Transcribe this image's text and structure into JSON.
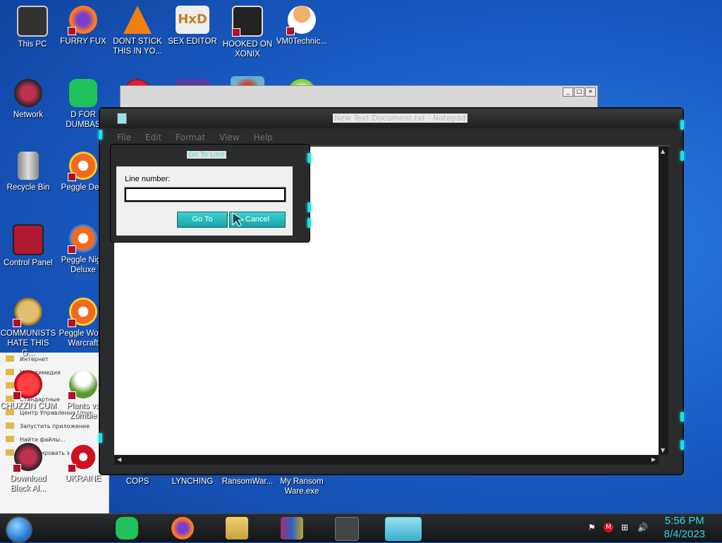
{
  "desktop": {
    "icons": [
      {
        "label": "This PC"
      },
      {
        "label": "FURRY FUX"
      },
      {
        "label": "DONT STICK THIS IN YO..."
      },
      {
        "label": "SEX EDITOR"
      },
      {
        "label": "HOOKED ON XONIX"
      },
      {
        "label": "VM0Technic..."
      },
      {
        "label": "Network"
      },
      {
        "label": "D FOR DUMBAS"
      },
      {
        "label": "Recycle Bin"
      },
      {
        "label": "Peggle Delu"
      },
      {
        "label": "Control Panel"
      },
      {
        "label": "Peggle Nigh Deluxe"
      },
      {
        "label": "COMMUNISTS HATE THIS G..."
      },
      {
        "label": "Peggle Wo of Warcraft"
      },
      {
        "label": "CHUZZIN CUM"
      },
      {
        "label": "Plants vs Zombie"
      },
      {
        "label": "Download Black Al..."
      },
      {
        "label": "UKRAINE"
      },
      {
        "label": "COPS"
      },
      {
        "label": "LYNCHING"
      },
      {
        "label": "RansomWar..."
      },
      {
        "label": "My Ransom Ware.exe"
      }
    ]
  },
  "notepad": {
    "title": "New Text Document.txt - Notepad",
    "menu": [
      "File",
      "Edit",
      "Format",
      "View",
      "Help"
    ]
  },
  "dialog": {
    "title": "Go To Line",
    "label": "Line number:",
    "value": "",
    "goto_label": "Go To",
    "cancel_label": "Cancel"
  },
  "taskbar": {
    "time": "5:56 PM",
    "date": "8/4/2023"
  },
  "colors": {
    "accent": "#1ee0e8",
    "chrome": "#2a2b2d"
  }
}
